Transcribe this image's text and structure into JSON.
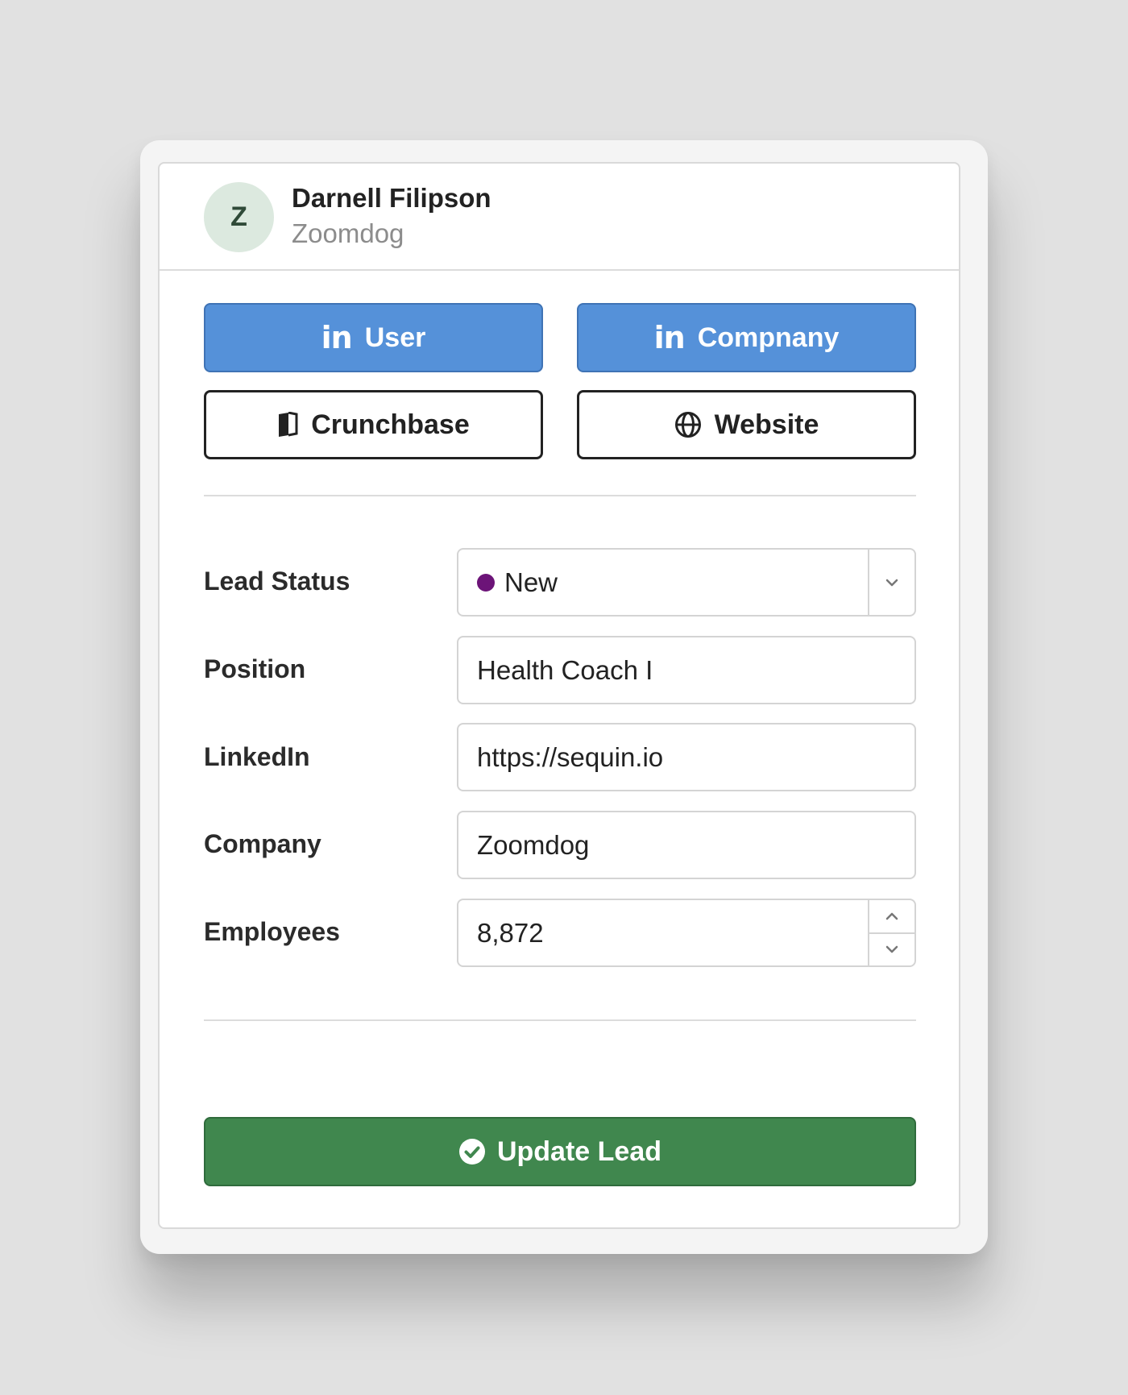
{
  "contact": {
    "avatar_initial": "Z",
    "name": "Darnell Filipson",
    "company": "Zoomdog"
  },
  "actions": {
    "linkedin_user": "User",
    "linkedin_company": "Compnany",
    "crunchbase": "Crunchbase",
    "website": "Website",
    "linkedin_icon_text": "in"
  },
  "form": {
    "lead_status": {
      "label": "Lead Status",
      "value": "New",
      "dot_color": "#6c1478"
    },
    "position": {
      "label": "Position",
      "value": "Health Coach I"
    },
    "linkedin": {
      "label": "LinkedIn",
      "value": "https://sequin.io"
    },
    "company": {
      "label": "Company",
      "value": "Zoomdog"
    },
    "employees": {
      "label": "Employees",
      "value": "8,872"
    }
  },
  "submit": {
    "label": "Update Lead"
  },
  "colors": {
    "linkedin_button": "#5591d9",
    "submit_button": "#40874e",
    "avatar_bg": "#dce9df"
  }
}
